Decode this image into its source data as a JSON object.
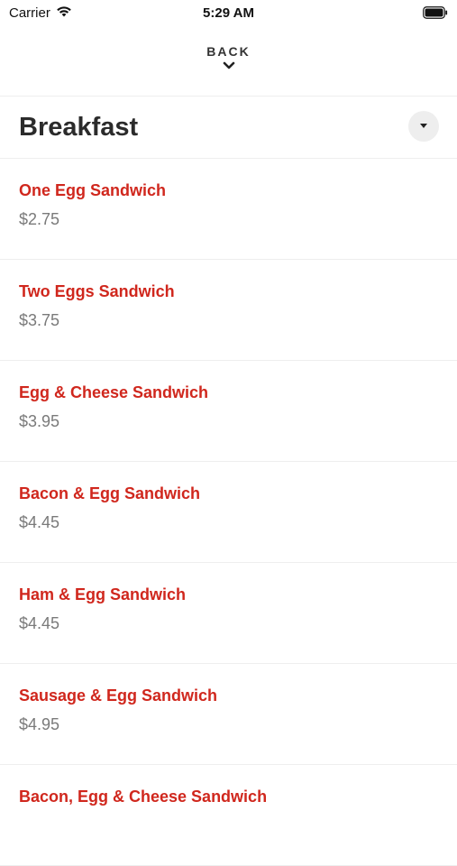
{
  "status_bar": {
    "carrier": "Carrier",
    "time": "5:29 AM",
    "wifi_icon": "wifi-icon",
    "battery_icon": "battery-icon"
  },
  "nav": {
    "back_label": "BACK",
    "back_icon": "chevron-down-icon"
  },
  "category": {
    "title": "Breakfast",
    "dropdown_icon": "triangle-down-icon"
  },
  "colors": {
    "item_name": "#d0271d",
    "price": "#7a7a7a",
    "divider": "#eeeeee",
    "dropdown_bg": "#eeeeee"
  },
  "menu": {
    "items": [
      {
        "name": "One Egg Sandwich",
        "price": "$2.75"
      },
      {
        "name": "Two Eggs Sandwich",
        "price": "$3.75"
      },
      {
        "name": "Egg & Cheese Sandwich",
        "price": "$3.95"
      },
      {
        "name": "Bacon & Egg Sandwich",
        "price": "$4.45"
      },
      {
        "name": "Ham & Egg Sandwich",
        "price": "$4.45"
      },
      {
        "name": "Sausage & Egg Sandwich",
        "price": "$4.95"
      },
      {
        "name": "Bacon, Egg & Cheese Sandwich",
        "price": ""
      }
    ]
  }
}
